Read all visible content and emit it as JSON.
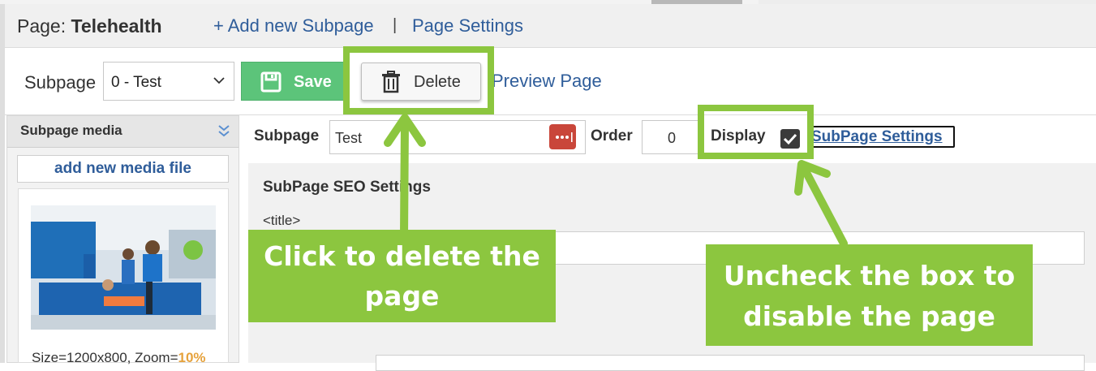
{
  "header": {
    "page_prefix": "Page: ",
    "page_name": "Telehealth",
    "add_subpage": "+ Add new Subpage",
    "separator": "|",
    "page_settings": "Page Settings"
  },
  "toolbar": {
    "subpage_label": "Subpage",
    "subpage_selected": "0 - Test",
    "save_label": "Save",
    "delete_label": "Delete",
    "preview_label": "Preview Page"
  },
  "media": {
    "title": "Subpage media",
    "add_label": "add new media file",
    "size_text": "Size=1200x800, Zoom=",
    "zoom_value": "10%"
  },
  "fields": {
    "subpage_label": "Subpage",
    "subpage_value": "Test",
    "order_label": "Order",
    "order_value": "0",
    "display_label": "Display",
    "display_checked": true,
    "settings_link": "SubPage Settings"
  },
  "seo": {
    "title": "SubPage SEO Settings",
    "title_tag": "<title>"
  },
  "annotations": {
    "delete_callout_line1": "Click to delete the",
    "delete_callout_line2": "page",
    "display_callout_line1": "Uncheck the box to",
    "display_callout_line2": "disable the page",
    "highlight_color": "#8cc63f"
  },
  "icons": {
    "save": "floppy-disk-icon",
    "delete": "trash-can-icon",
    "select_chevron": "chevron-down-icon",
    "media_collapse": "double-chevron-down-icon",
    "dots": "ellipsis-icon",
    "check": "checkmark-icon"
  }
}
